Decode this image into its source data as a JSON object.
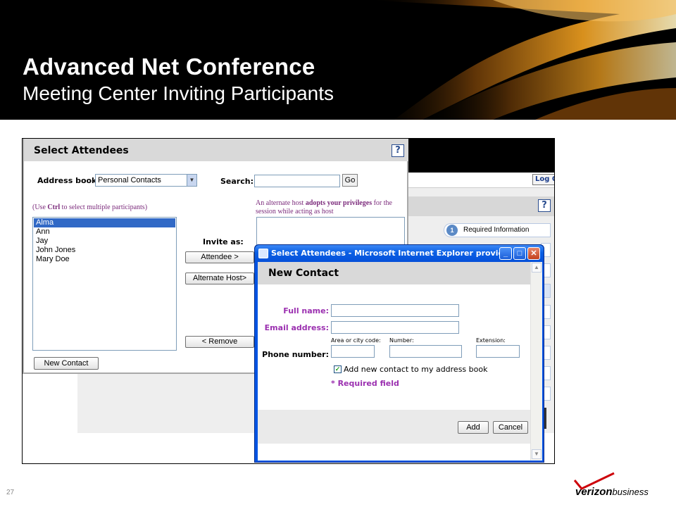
{
  "slide": {
    "title": "Advanced Net Conference",
    "subtitle": "Meeting Center Inviting Participants",
    "page_number": "27",
    "brand": {
      "name": "verizon",
      "suffix": "business",
      "accent": "#cd040b"
    }
  },
  "background_app": {
    "logout_label": "Log O",
    "help_label": "?",
    "steps": [
      {
        "number": "1",
        "label": "Required Information"
      }
    ]
  },
  "select_attendees": {
    "title": "Select Attendees",
    "help_label": "?",
    "address_book_label": "Address book:",
    "address_book_value": "Personal Contacts",
    "search_label": "Search:",
    "search_value": "",
    "go_label": "Go",
    "hint_prefix": "(Use ",
    "hint_key": "Ctrl",
    "hint_suffix": " to select multiple participants)",
    "alternate_host_note_1": "An alternate host ",
    "alternate_host_note_bold": "adopts your privileges",
    "alternate_host_note_2": " for the session while acting as host",
    "contacts": [
      {
        "name": "Alma",
        "selected": true
      },
      {
        "name": "Ann",
        "selected": false
      },
      {
        "name": "Jay",
        "selected": false
      },
      {
        "name": "John Jones",
        "selected": false
      },
      {
        "name": "Mary Doe",
        "selected": false
      }
    ],
    "invite_as_label": "Invite as:",
    "attendee_button": "Attendee >",
    "alternate_host_button": "Alternate Host>",
    "remove_button": "< Remove",
    "new_contact_button": "New Contact"
  },
  "ie_window": {
    "title": "Select Attendees - Microsoft Internet Explorer provided by V...",
    "minimize": "_",
    "maximize": "□",
    "close": "✕"
  },
  "new_contact": {
    "title": "New Contact",
    "full_name_label": "Full name:",
    "email_label": "Email address:",
    "phone_label": "Phone number:",
    "area_code_label": "Area or city code:",
    "number_label": "Number:",
    "extension_label": "Extension:",
    "add_to_book_label": "Add new contact to my address book",
    "add_to_book_checked": true,
    "required_note": "* Required field",
    "add_button": "Add",
    "cancel_button": "Cancel",
    "values": {
      "full_name": "",
      "email": "",
      "area_code": "",
      "number": "",
      "extension": ""
    }
  }
}
